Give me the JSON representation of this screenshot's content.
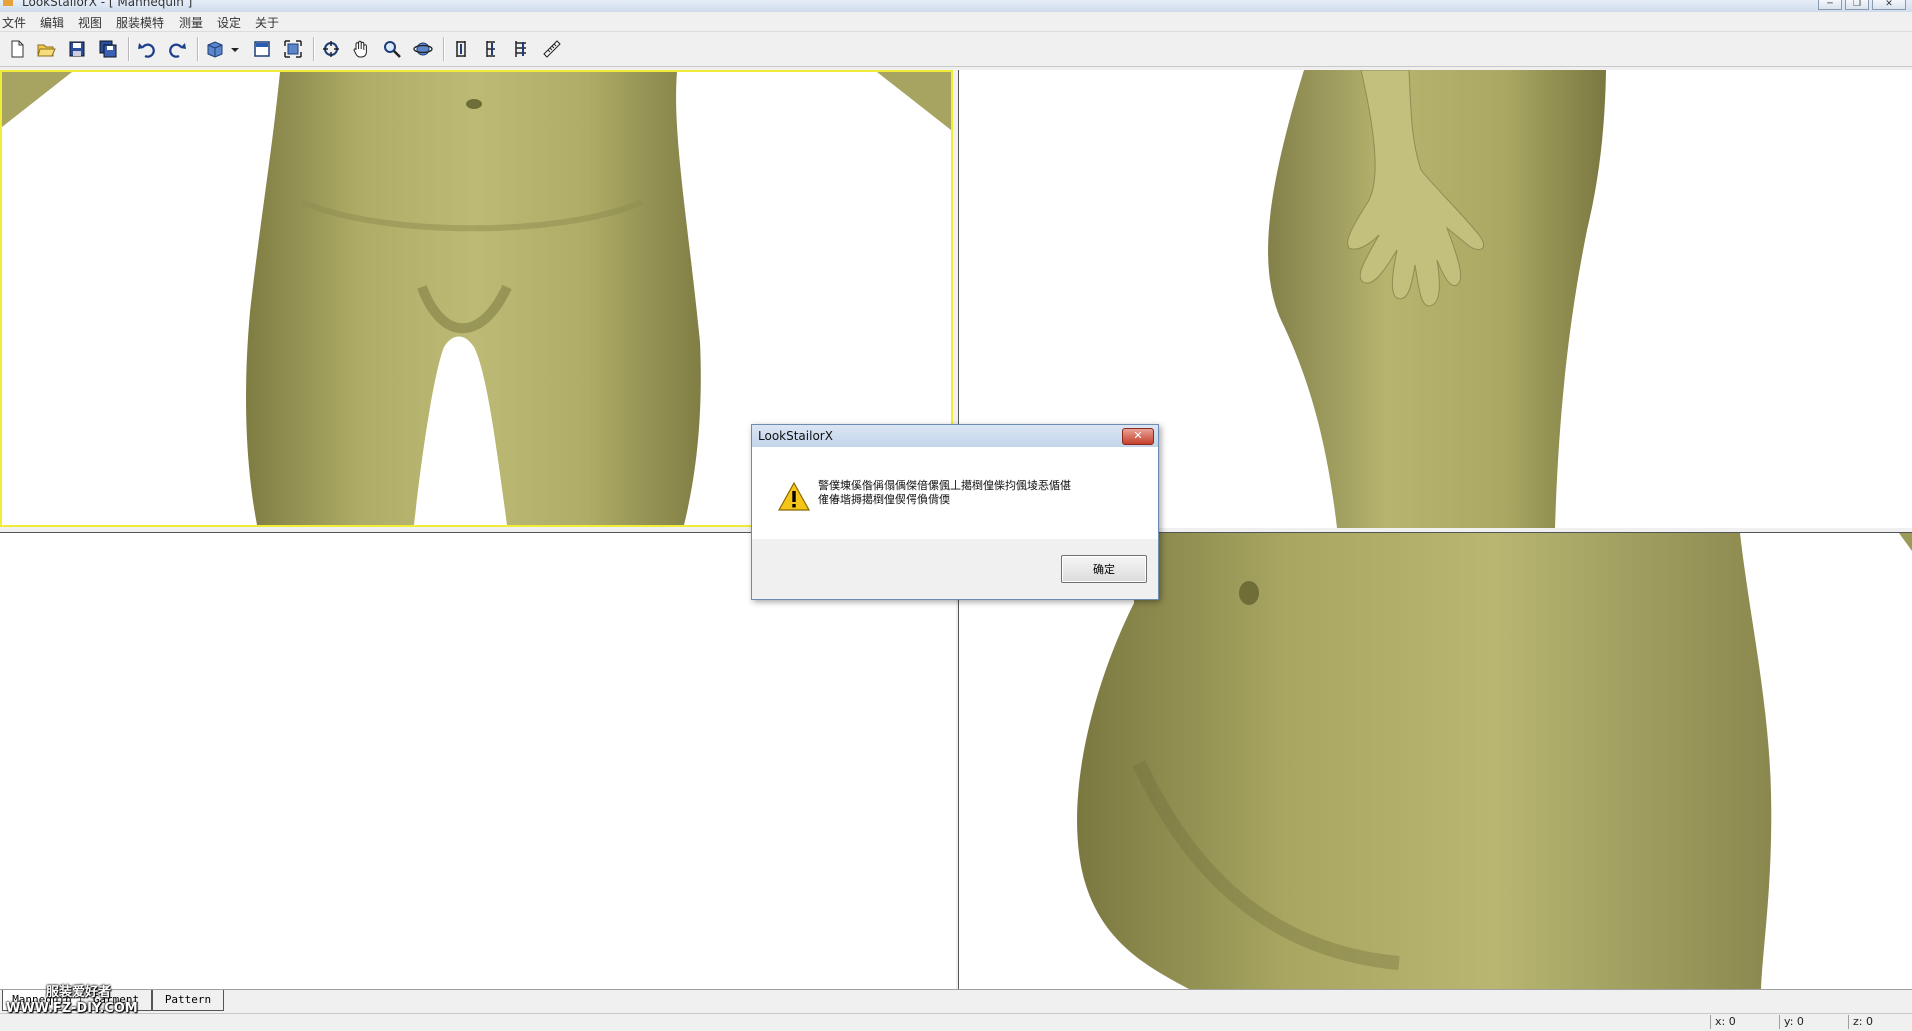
{
  "window": {
    "title": "LookStailorX - [ Mannequin ]",
    "minimize": "─",
    "maximize": "❐",
    "close": "✕"
  },
  "menu": [
    "文件",
    "编辑",
    "视图",
    "服装模特",
    "测量",
    "设定",
    "关于"
  ],
  "toolbar_icons": [
    "new-file-icon",
    "open-folder-icon",
    "save-icon",
    "save-all-icon",
    "undo-icon",
    "redo-icon",
    "view-cube-icon",
    "dropdown-arrow-icon",
    "single-view-icon",
    "fit-view-icon",
    "rotate-icon",
    "pan-hand-icon",
    "zoom-icon",
    "orbit-icon",
    "measure-vertical-icon",
    "measure-vertical-2-icon",
    "measure-vertical-3-icon",
    "ruler-icon"
  ],
  "tabs": [
    "Mannequin",
    "Garment",
    "Pattern"
  ],
  "status": {
    "x": "x: 0",
    "y": "y: 0",
    "z": "z: 0"
  },
  "watermark": {
    "line1": "服装爱好者",
    "line2": "WWW.FZ-DIY.COM"
  },
  "dialog": {
    "title": "LookStailorX",
    "close": "✕",
    "message_line1": "警僕埬傒偺偁傝偊傑偣傫偑丄擖椡偟偨抣偑堎忢偱偡",
    "message_line2": "傕偆堦搙擖椡偟偰偔偩偝偄",
    "ok": "确定"
  },
  "colors": {
    "skin": "#b2b06a",
    "skin_dark": "#7e7c42",
    "viewport_active": "#f0ec3a",
    "bg": "#f0f0f0"
  }
}
